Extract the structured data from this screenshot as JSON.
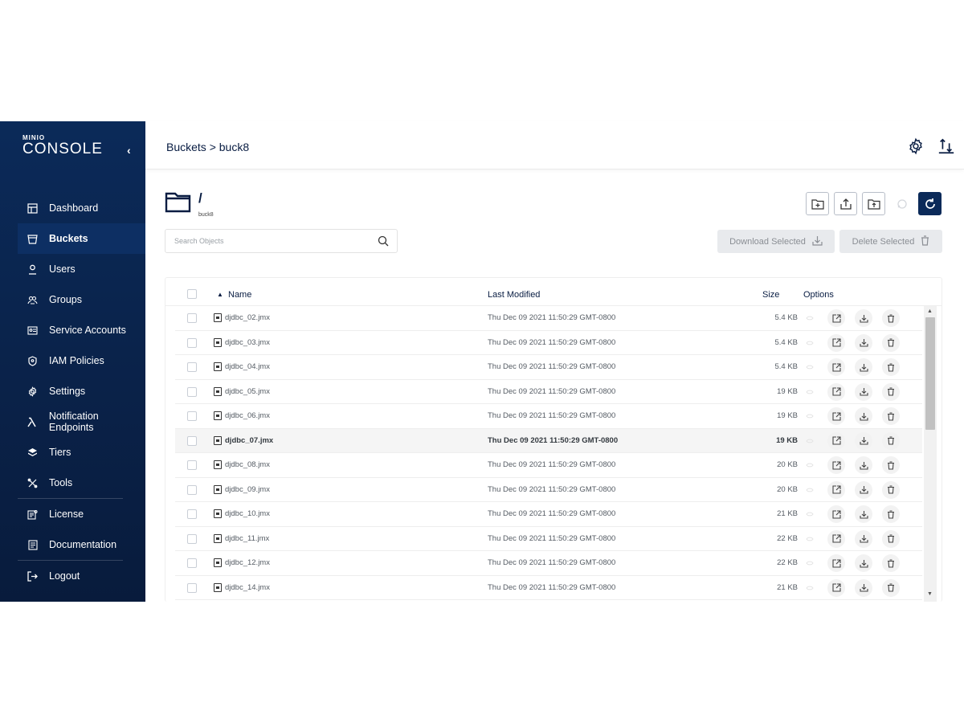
{
  "logo": {
    "top": "MINIO",
    "main": "CONSOLE"
  },
  "sidebar": {
    "items": [
      {
        "label": "Dashboard",
        "icon": "dashboard-icon"
      },
      {
        "label": "Buckets",
        "icon": "bucket-icon",
        "active": true
      },
      {
        "label": "Users",
        "icon": "user-icon"
      },
      {
        "label": "Groups",
        "icon": "groups-icon"
      },
      {
        "label": "Service Accounts",
        "icon": "service-accounts-icon"
      },
      {
        "label": "IAM Policies",
        "icon": "shield-icon"
      },
      {
        "label": "Settings",
        "icon": "gear-icon"
      },
      {
        "label": "Notification Endpoints",
        "icon": "lambda-icon"
      },
      {
        "label": "Tiers",
        "icon": "tiers-icon"
      },
      {
        "label": "Tools",
        "icon": "tools-icon"
      },
      {
        "label": "License",
        "icon": "license-icon"
      },
      {
        "label": "Documentation",
        "icon": "documentation-icon"
      },
      {
        "label": "Logout",
        "icon": "logout-icon"
      }
    ]
  },
  "header": {
    "breadcrumb": "Buckets > buck8"
  },
  "path": {
    "slash": "/",
    "bucket": "buck8"
  },
  "search": {
    "placeholder": "Search Objects"
  },
  "buttons": {
    "download": "Download Selected",
    "delete": "Delete Selected"
  },
  "table": {
    "headers": {
      "name": "Name",
      "modified": "Last Modified",
      "size": "Size",
      "options": "Options"
    },
    "sort_indicator": "▲",
    "rows": [
      {
        "name": "djdbc_02.jmx",
        "modified": "Thu Dec 09 2021 11:50:29 GMT-0800",
        "size": "5.4 KB"
      },
      {
        "name": "djdbc_03.jmx",
        "modified": "Thu Dec 09 2021 11:50:29 GMT-0800",
        "size": "5.4 KB"
      },
      {
        "name": "djdbc_04.jmx",
        "modified": "Thu Dec 09 2021 11:50:29 GMT-0800",
        "size": "5.4 KB"
      },
      {
        "name": "djdbc_05.jmx",
        "modified": "Thu Dec 09 2021 11:50:29 GMT-0800",
        "size": "19 KB"
      },
      {
        "name": "djdbc_06.jmx",
        "modified": "Thu Dec 09 2021 11:50:29 GMT-0800",
        "size": "19 KB"
      },
      {
        "name": "djdbc_07.jmx",
        "modified": "Thu Dec 09 2021 11:50:29 GMT-0800",
        "size": "19 KB",
        "highlighted": true
      },
      {
        "name": "djdbc_08.jmx",
        "modified": "Thu Dec 09 2021 11:50:29 GMT-0800",
        "size": "20 KB"
      },
      {
        "name": "djdbc_09.jmx",
        "modified": "Thu Dec 09 2021 11:50:29 GMT-0800",
        "size": "20 KB"
      },
      {
        "name": "djdbc_10.jmx",
        "modified": "Thu Dec 09 2021 11:50:29 GMT-0800",
        "size": "21 KB"
      },
      {
        "name": "djdbc_11.jmx",
        "modified": "Thu Dec 09 2021 11:50:29 GMT-0800",
        "size": "22 KB"
      },
      {
        "name": "djdbc_12.jmx",
        "modified": "Thu Dec 09 2021 11:50:29 GMT-0800",
        "size": "22 KB"
      },
      {
        "name": "djdbc_14.jmx",
        "modified": "Thu Dec 09 2021 11:50:29 GMT-0800",
        "size": "21 KB"
      }
    ]
  },
  "colors": {
    "sidebar": "#0b2a59",
    "accent": "#0b2a59",
    "text": "#081c42"
  }
}
